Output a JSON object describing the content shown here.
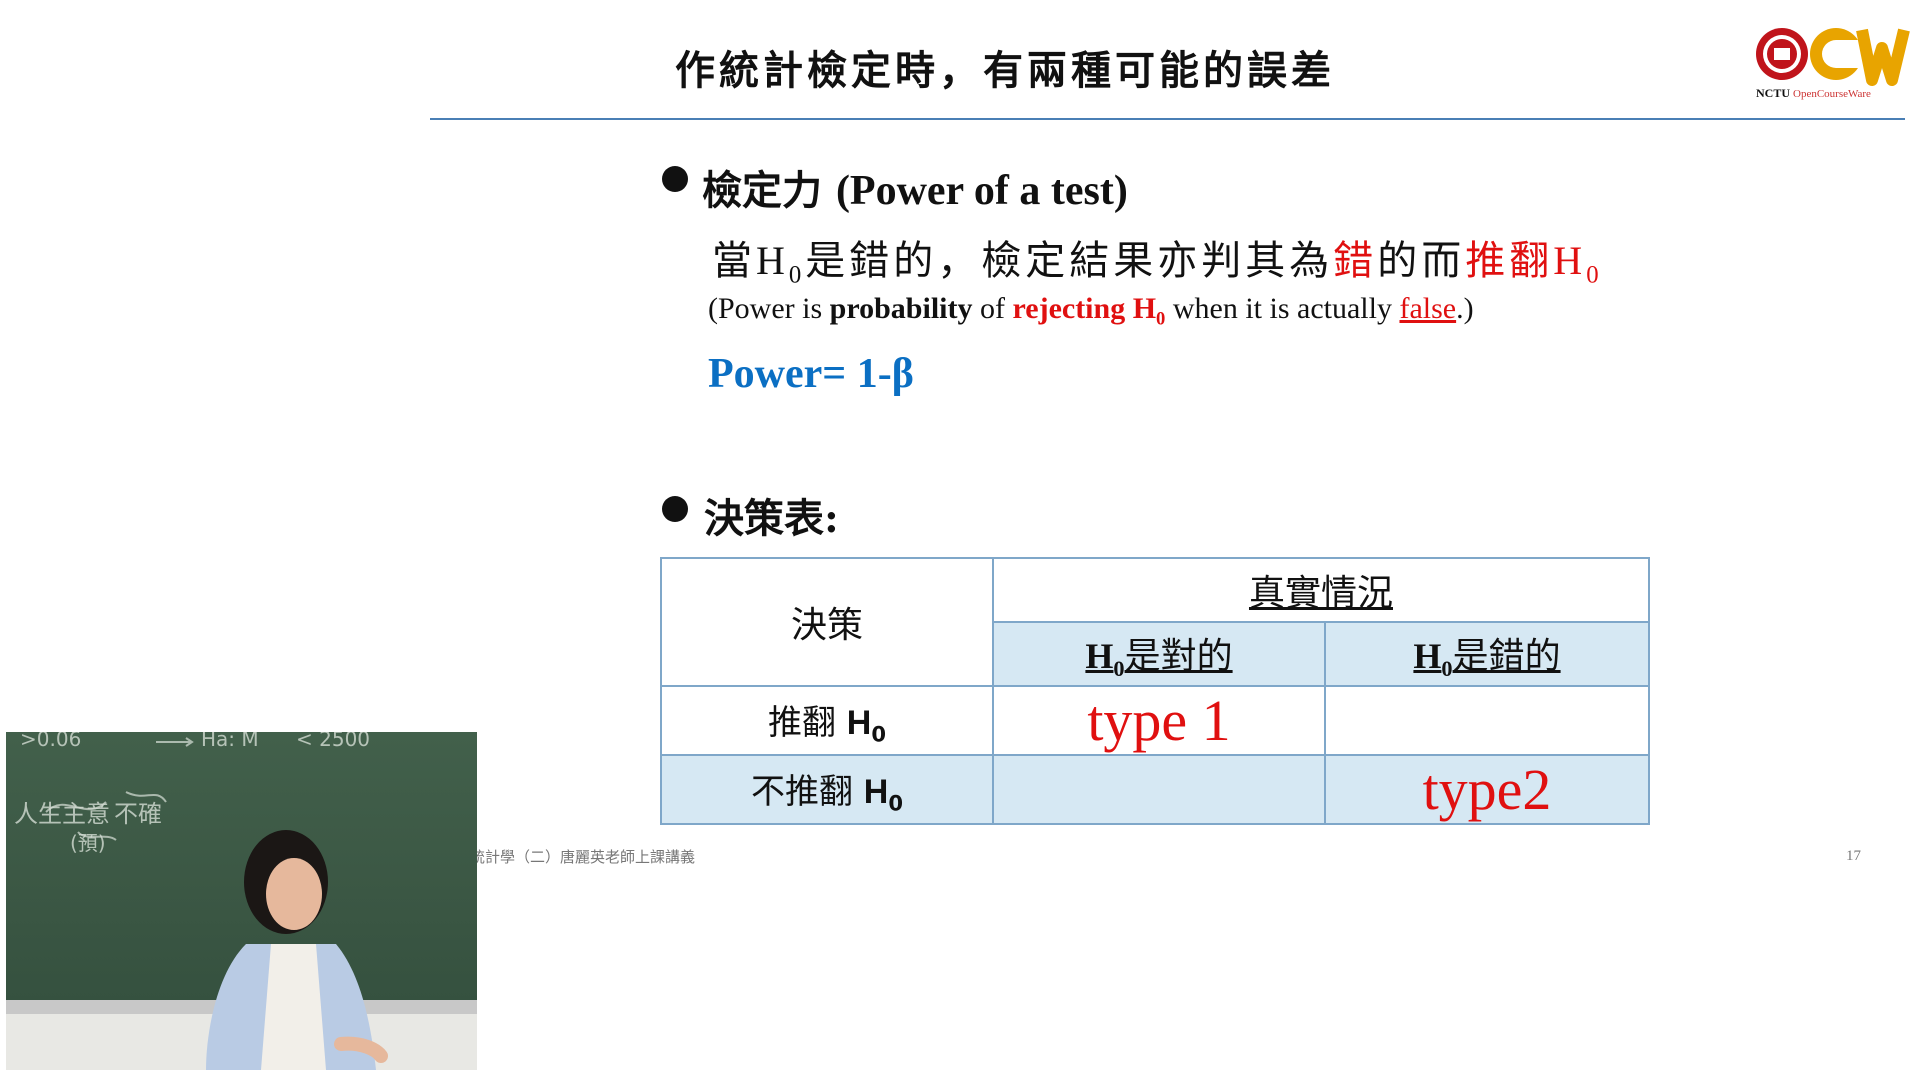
{
  "slide": {
    "title": "作統計檢定時，有兩種可能的誤差",
    "logo": {
      "brand": "NCTU",
      "sub": "OpenCourseWare",
      "mark": "OCW"
    },
    "bullet1": {
      "heading_cn": "檢定力",
      "heading_en": "(Power of a test)",
      "cn_line": {
        "pre": "當",
        "h": "H",
        "h_sub": "0",
        "mid": "是錯的，檢定結果亦判其為",
        "red1": "錯",
        "mid2": "的而",
        "red2": "推翻",
        "red_h": "H",
        "red_h_sub": "0"
      },
      "en_line": {
        "p1": "(Power is ",
        "b1": "probability",
        "p2": " of ",
        "r1": "rejecting H",
        "r1_sub": "0",
        "p3": " when it is actually ",
        "u1": "false",
        "p4": ".)"
      },
      "formula": "Power= 1-β"
    },
    "bullet2": {
      "heading": "決策表:"
    },
    "table": {
      "decision_label": "決策",
      "truth_label": "真實情況",
      "col1": {
        "h": "H",
        "sub": "0",
        "text": "是對的"
      },
      "col2": {
        "h": "H",
        "sub": "0",
        "text": "是錯的"
      },
      "row1": {
        "label": "推翻",
        "h": "H",
        "sub": "0",
        "cell1": "type 1",
        "cell2": ""
      },
      "row2": {
        "label": "不推翻",
        "h": "H",
        "sub": "0",
        "cell1": "",
        "cell2": "type2"
      }
    },
    "footer": "統計學（二）唐麗英老師上課講義",
    "page_number": "17"
  },
  "video": {
    "chalk_text": [
      ">0.06",
      "Ha: M",
      "< 2500",
      "人生主意",
      "不確",
      "(預)"
    ]
  },
  "colors": {
    "accent_red": "#e01010",
    "formula_blue": "#0b6fc3",
    "table_fill": "#d6e8f3",
    "table_border": "#7fa7c9",
    "rule": "#4a7fb5"
  }
}
